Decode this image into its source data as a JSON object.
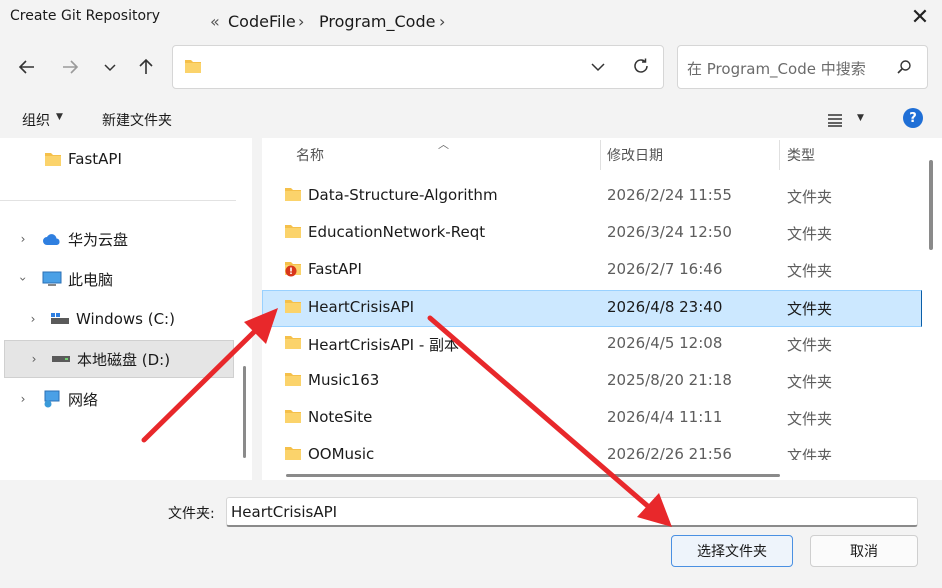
{
  "window": {
    "title": "Create Git Repository"
  },
  "address": {
    "overflow": "«",
    "crumbs": [
      "CodeFile",
      "Program_Code"
    ]
  },
  "search": {
    "placeholder": "在 Program_Code 中搜索"
  },
  "toolbar": {
    "organize": "组织",
    "new_folder": "新建文件夹"
  },
  "sidebar": {
    "items": [
      {
        "label": "FastAPI",
        "icon": "folder-icon"
      },
      {
        "label": "华为云盘",
        "icon": "cloud-icon"
      },
      {
        "label": "此电脑",
        "icon": "pc-icon"
      },
      {
        "label": "Windows (C:)",
        "icon": "drive-icon"
      },
      {
        "label": "本地磁盘 (D:)",
        "icon": "drive-icon"
      },
      {
        "label": "网络",
        "icon": "network-icon"
      }
    ]
  },
  "columns": {
    "name": "名称",
    "date": "修改日期",
    "type": "类型"
  },
  "files": [
    {
      "name": "Data-Structure-Algorithm",
      "date": "2026/2/24 11:55",
      "type": "文件夹"
    },
    {
      "name": "EducationNetwork-Reqt",
      "date": "2026/3/24 12:50",
      "type": "文件夹"
    },
    {
      "name": "FastAPI",
      "date": "2026/2/7 16:46",
      "type": "文件夹"
    },
    {
      "name": "HeartCrisisAPI",
      "date": "2026/4/8 23:40",
      "type": "文件夹"
    },
    {
      "name": "HeartCrisisAPI - 副本",
      "date": "2026/4/5 12:08",
      "type": "文件夹"
    },
    {
      "name": "Music163",
      "date": "2025/8/20 21:18",
      "type": "文件夹"
    },
    {
      "name": "NoteSite",
      "date": "2026/4/4 11:11",
      "type": "文件夹"
    },
    {
      "name": "OOMusic",
      "date": "2026/2/26 21:56",
      "type": "文件夹"
    }
  ],
  "bottom": {
    "folder_label": "文件夹:",
    "folder_value": "HeartCrisisAPI",
    "select_button": "选择文件夹",
    "cancel_button": "取消"
  },
  "colors": {
    "accent": "#1f6fd6",
    "selection": "#cce8ff",
    "annotation_arrow": "#e8282b",
    "folder": "#f5c04a"
  }
}
